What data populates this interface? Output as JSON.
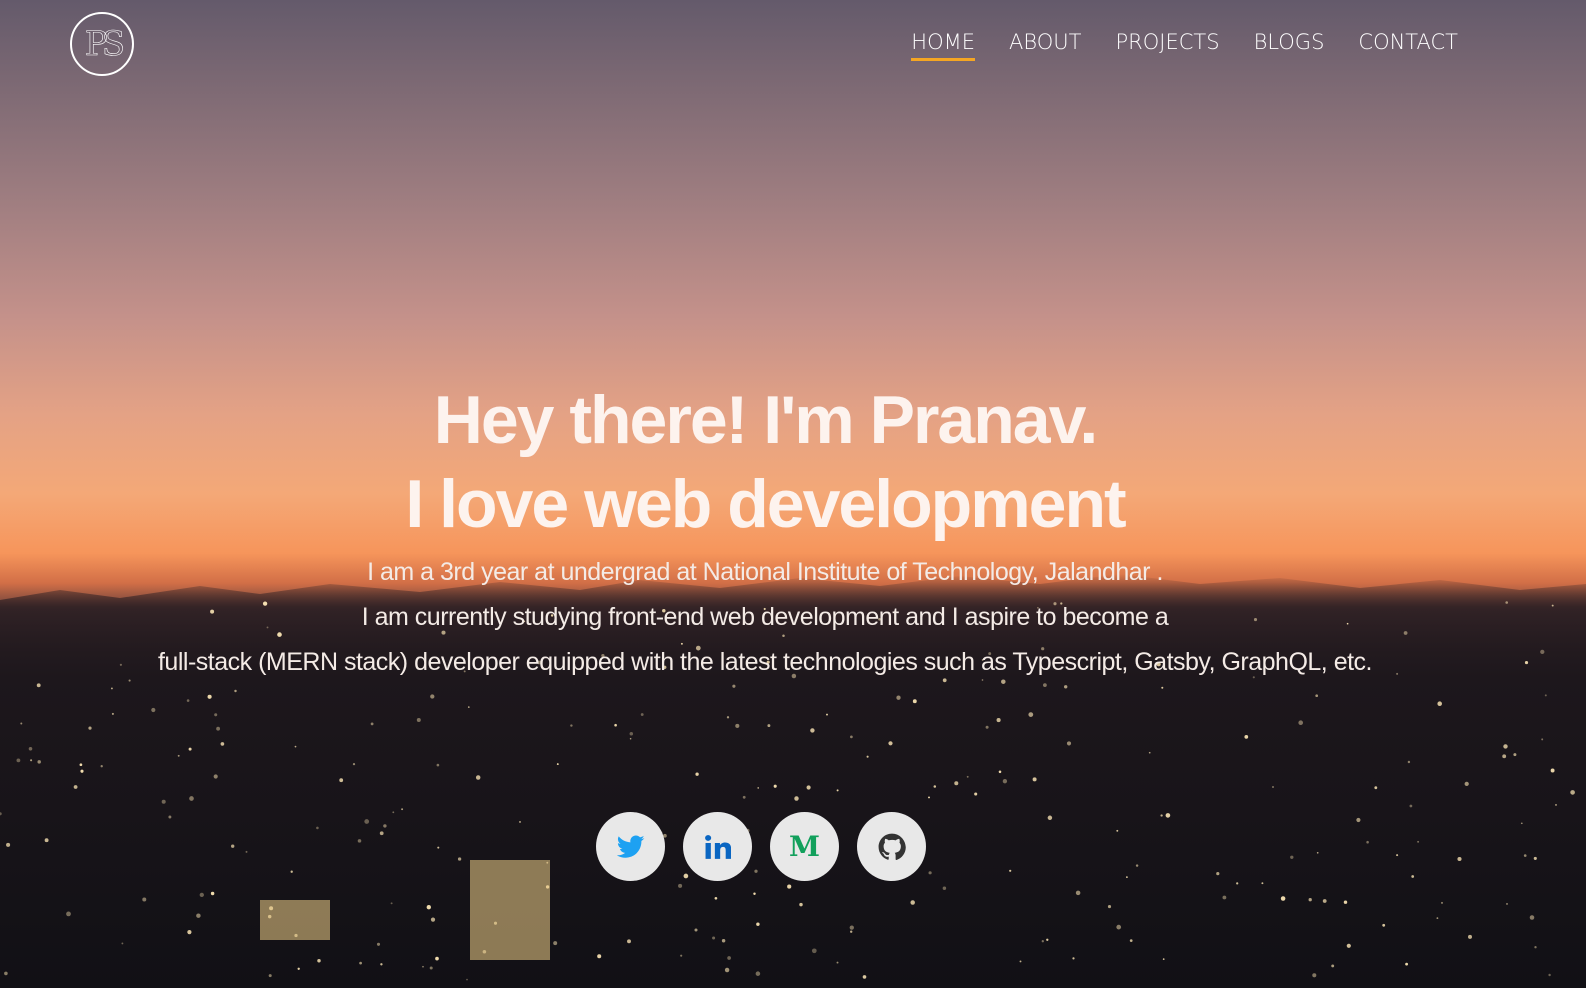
{
  "logo": {
    "text": "PS"
  },
  "nav": {
    "items": [
      "HOME",
      "ABOUT",
      "PROJECTS",
      "BLOGS",
      "CONTACT"
    ],
    "active": "HOME",
    "accent": "#f5a623"
  },
  "hero": {
    "headline_line1": "Hey there! I'm Pranav.",
    "headline_line2": "I love web development",
    "bio_line1": "I am a 3rd year at undergrad at National Institute of Technology, Jalandhar .",
    "bio_line2": "I am currently studying front-end web development and I aspire to become a",
    "bio_line3": "full-stack (MERN stack) developer equipped with the latest technologies such as Typescript, Gatsby, GraphQL, etc."
  },
  "socials": [
    {
      "name": "twitter",
      "icon": "twitter-icon",
      "color": "#1da1f2"
    },
    {
      "name": "linkedin",
      "icon": "linkedin-icon",
      "color": "#0a66c2"
    },
    {
      "name": "medium",
      "icon": "medium-icon",
      "color": "#12a05c",
      "glyph": "M"
    },
    {
      "name": "github",
      "icon": "github-icon",
      "color": "#333333"
    }
  ]
}
